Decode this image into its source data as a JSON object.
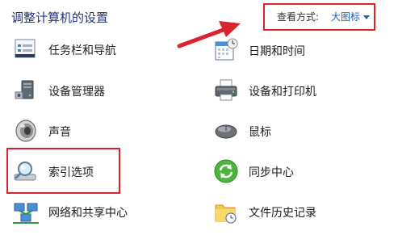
{
  "header": {
    "title": "调整计算机的设置",
    "view_label": "查看方式:",
    "view_value": "大图标"
  },
  "items": [
    {
      "label": "任务栏和导航",
      "icon": "taskbar-icon"
    },
    {
      "label": "日期和时间",
      "icon": "calendar-clock-icon"
    },
    {
      "label": "设备管理器",
      "icon": "device-manager-icon"
    },
    {
      "label": "设备和打印机",
      "icon": "printer-icon"
    },
    {
      "label": "声音",
      "icon": "speaker-icon"
    },
    {
      "label": "鼠标",
      "icon": "mouse-icon"
    },
    {
      "label": "索引选项",
      "icon": "search-index-icon"
    },
    {
      "label": "同步中心",
      "icon": "sync-icon"
    },
    {
      "label": "网络和共享中心",
      "icon": "network-icon"
    },
    {
      "label": "文件历史记录",
      "icon": "file-history-icon"
    }
  ],
  "colors": {
    "title": "#1e3287",
    "link": "#1a5fb4",
    "annotation_red": "#d9232d"
  }
}
